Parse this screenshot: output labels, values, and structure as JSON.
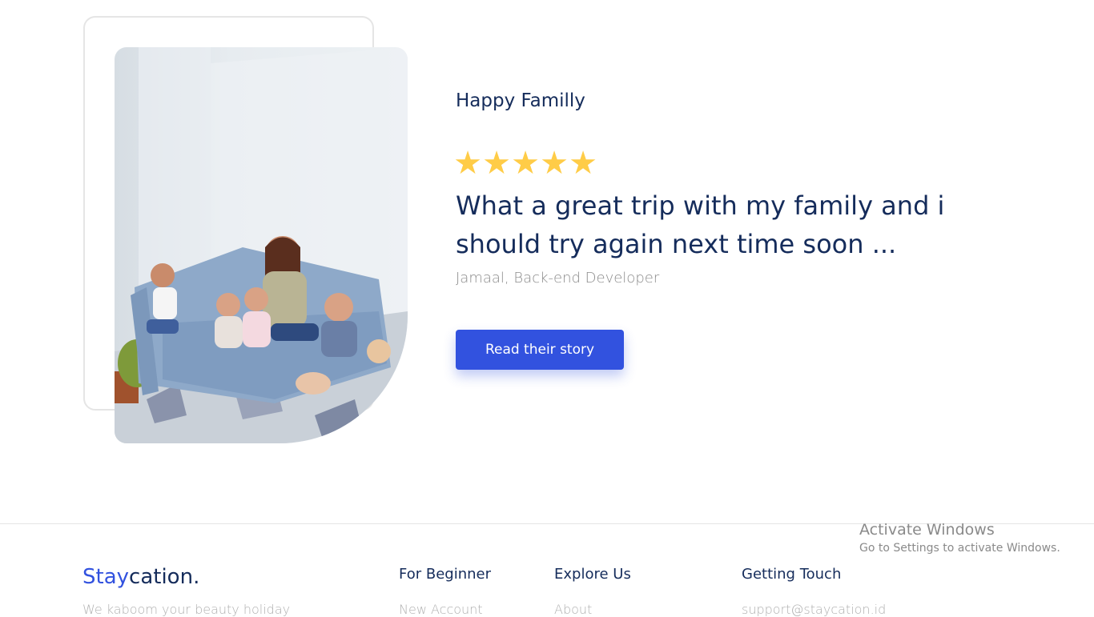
{
  "testimonial": {
    "title": "Happy Familly",
    "rating": 5,
    "stars": [
      "★",
      "★",
      "★",
      "★",
      "★"
    ],
    "quote": "What a great trip with my family and i should try again next time soon ...",
    "author": "Jamaal, Back-end Developer",
    "button_label": "Read their story",
    "image_icon": "family-photo"
  },
  "footer": {
    "brand": {
      "accent": "Stay",
      "rest": "cation."
    },
    "tagline": "We kaboom your beauty holiday",
    "columns": [
      {
        "heading": "For Beginner",
        "first_link": "New Account"
      },
      {
        "heading": "Explore Us",
        "first_link": "About"
      },
      {
        "heading": "Getting Touch",
        "first_link": "support@staycation.id"
      }
    ]
  },
  "windows_watermark": {
    "title": "Activate Windows",
    "subtitle": "Go to Settings to activate Windows."
  },
  "colors": {
    "primary": "#3252DF",
    "text": "#152C5B",
    "muted": "#B0B0B0",
    "star": "#FFCC47"
  }
}
